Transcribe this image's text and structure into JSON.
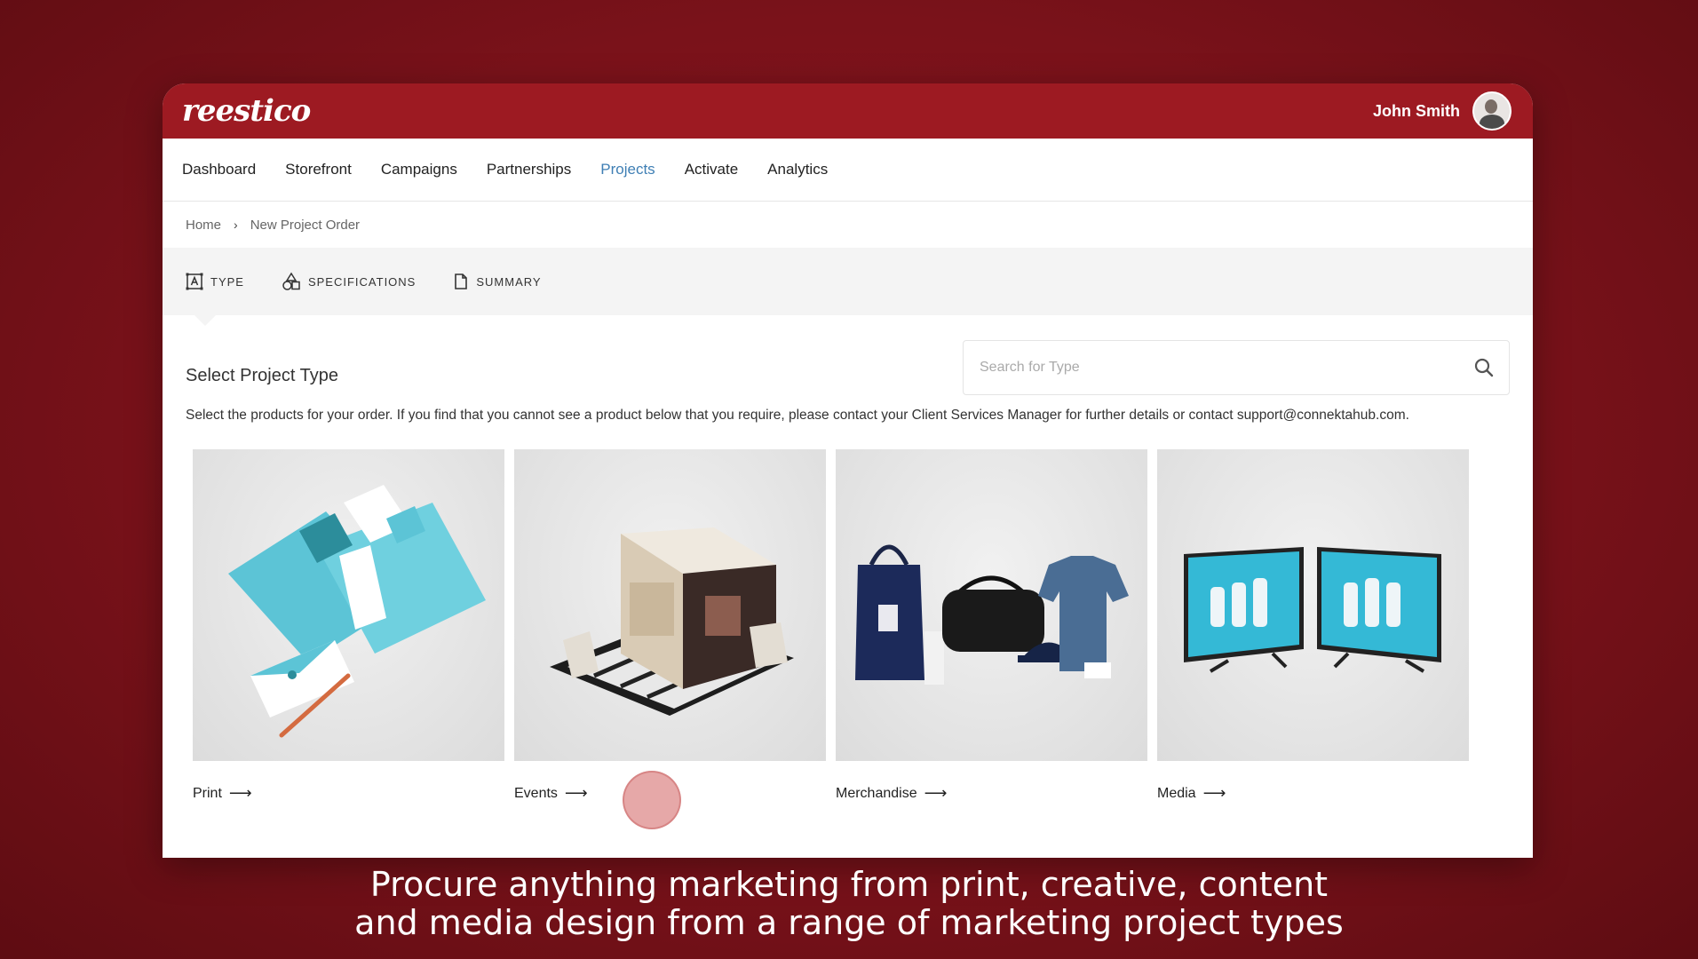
{
  "app": {
    "logo_text": "reestico",
    "user_name": "John Smith"
  },
  "nav": {
    "items": [
      {
        "label": "Dashboard"
      },
      {
        "label": "Storefront"
      },
      {
        "label": "Campaigns"
      },
      {
        "label": "Partnerships"
      },
      {
        "label": "Projects",
        "active": true
      },
      {
        "label": "Activate"
      },
      {
        "label": "Analytics"
      }
    ]
  },
  "breadcrumb": {
    "home": "Home",
    "separator": "›",
    "current": "New Project Order"
  },
  "steps": [
    {
      "label": "TYPE",
      "icon": "type-icon"
    },
    {
      "label": "SPECIFICATIONS",
      "icon": "shapes-icon"
    },
    {
      "label": "SUMMARY",
      "icon": "document-icon"
    }
  ],
  "main": {
    "title": "Select Project Type",
    "search_placeholder": "Search for Type",
    "description": "Select the products for your order. If you find that you cannot see a product below that you require, please contact your Client Services Manager for further details or contact support@connektahub.com."
  },
  "cards": [
    {
      "label": "Print",
      "arrow": "⟶"
    },
    {
      "label": "Events",
      "arrow": "⟶"
    },
    {
      "label": "Merchandise",
      "arrow": "⟶"
    },
    {
      "label": "Media",
      "arrow": "⟶"
    }
  ],
  "caption": {
    "line1": "Procure anything marketing from print, creative, content",
    "line2": "and media design from a range of marketing project types"
  },
  "colors": {
    "brand_red": "#9d1a22",
    "active_nav": "#3f7fb4",
    "background": "#7a121a"
  }
}
